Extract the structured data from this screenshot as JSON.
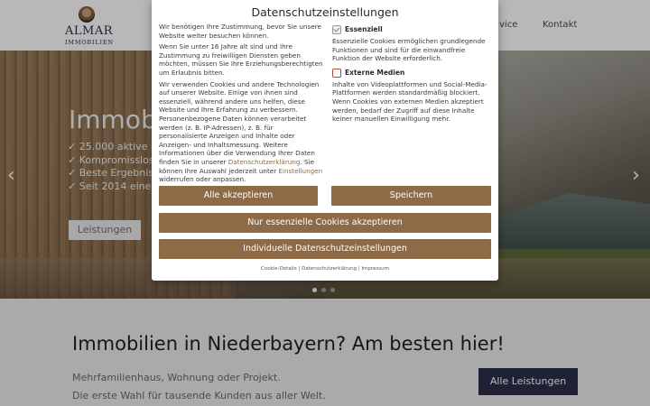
{
  "site": {
    "logo_name": "ALMAR",
    "logo_sub": "IMMOBILIEN",
    "nav": [
      "vice",
      "Kontakt"
    ]
  },
  "hero": {
    "title": "Immobi",
    "list": [
      "✓ 25.000 aktive S",
      "✓ Kompromisslos",
      "✓ Beste Ergebniss",
      "✓ Seit 2014 eine f"
    ],
    "button": "Leistungen",
    "prev": "‹",
    "next": "›",
    "slides": 3,
    "active_slide": 0
  },
  "section": {
    "title": "Immobilien in Niederbayern? Am besten hier!",
    "line1": "Mehrfamilienhaus, Wohnung oder Projekt.",
    "line2": "Die erste Wahl für tausende Kunden aus aller Welt.",
    "button": "Alle Leistungen"
  },
  "consent": {
    "title": "Datenschutzeinstellungen",
    "p1": "Wir benötigen Ihre Zustimmung, bevor Sie unsere Website weiter besuchen können.",
    "p2": "Wenn Sie unter 16 Jahre alt sind und Ihre Zustimmung zu freiwilligen Diensten geben möchten, müssen Sie Ihre Erziehungsberechtigten um Erlaubnis bitten.",
    "p3_a": "Wir verwenden Cookies und andere Technologien auf unserer Website. Einige von ihnen sind essenziell, während andere uns helfen, diese Website und Ihre Erfahrung zu verbessern. Personenbezogene Daten können verarbeitet werden (z. B. IP-Adressen), z. B. für personalisierte Anzeigen und Inhalte oder Anzeigen- und Inhaltsmessung. Weitere Informationen über die Verwendung Ihrer Daten finden Sie in unserer ",
    "p3_link1": "Datenschutzerklärung",
    "p3_b": ". Sie können Ihre Auswahl jederzeit unter ",
    "p3_link2": "Einstellungen",
    "p3_c": " widerrufen oder anpassen.",
    "essential_label": "Essenziell",
    "essential_checked": true,
    "essential_desc": "Essenzielle Cookies ermöglichen grundlegende Funktionen und sind für die einwandfreie Funktion der Website erforderlich.",
    "external_label": "Externe Medien",
    "external_checked": false,
    "external_desc": "Inhalte von Videoplattformen und Social-Media-Plattformen werden standardmäßig blockiert. Wenn Cookies von externen Medien akzeptiert werden, bedarf der Zugriff auf diese Inhalte keiner manuellen Einwilligung mehr.",
    "accept_all": "Alle akzeptieren",
    "save": "Speichern",
    "accept_essential": "Nur essenzielle Cookies akzeptieren",
    "individual": "Individuelle Datenschutzeinstellungen",
    "footer_link1": "Cookie-Details",
    "footer_sep": " | ",
    "footer_link2": "Datenschutzerklärung",
    "footer_link3": "Impressum"
  },
  "colors": {
    "brand": "#8e6a47",
    "navy": "#2b2f4a",
    "checkbox_red": "#b4443c"
  }
}
